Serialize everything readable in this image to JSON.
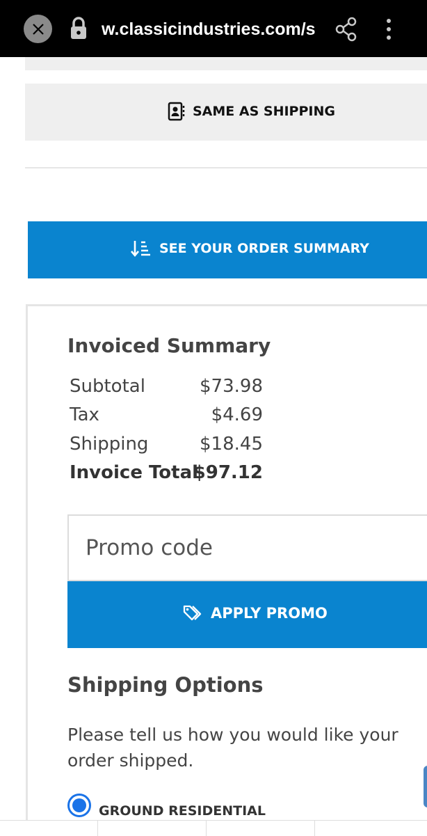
{
  "browser": {
    "url": "w.classicindustries.com/s",
    "icons": [
      "close-icon",
      "lock-icon",
      "share-icon",
      "more-vert-icon"
    ]
  },
  "billing": {
    "same_as_shipping_label": "SAME AS SHIPPING",
    "icon": "contact-card-icon"
  },
  "order_summary_button": {
    "label": "SEE YOUR ORDER SUMMARY",
    "icon": "sort-down-icon"
  },
  "invoiced_summary": {
    "title": "Invoiced Summary",
    "rows": [
      {
        "label": "Subtotal",
        "value": "$73.98"
      },
      {
        "label": "Tax",
        "value": "$4.69"
      },
      {
        "label": "Shipping",
        "value": "$18.45"
      },
      {
        "label": "Invoice Total",
        "value": "$97.12"
      }
    ]
  },
  "promo": {
    "placeholder": "Promo code",
    "value": "",
    "apply_label": "APPLY PROMO",
    "icon": "tag-icon"
  },
  "shipping_options": {
    "title": "Shipping Options",
    "description": "Please tell us how you would like your order shipped.",
    "selected_option": "GROUND RESIDENTIAL"
  },
  "colors": {
    "accent": "#0a84cf",
    "radio": "#1a73e8",
    "panel_bg": "#efefef"
  }
}
